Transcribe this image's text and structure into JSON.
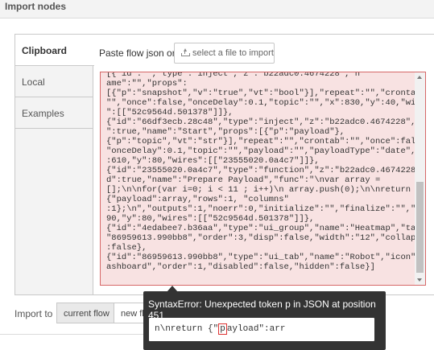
{
  "dialog": {
    "title": "Import nodes"
  },
  "tabs": [
    {
      "label": "Clipboard",
      "active": true
    },
    {
      "label": "Local",
      "active": false
    },
    {
      "label": "Examples",
      "active": false
    }
  ],
  "clipboard": {
    "paste_label": "Paste flow json or",
    "file_button_label": "select a file to import",
    "file_icon": "upload-icon"
  },
  "editor": {
    "lines": [
      "[{\"id\":\"\",\"type\":\"inject\",\"z\":\"b22adc0.4674228\",\"n",
      "ame\":\"\",\"props\":",
      "[{\"p\":\"snapshot\",\"v\":\"true\",\"vt\":\"bool\"}],\"repeat\":\"\",\"crontab\":",
      "\"\",\"once\":false,\"onceDelay\":0.1,\"topic\":\"\",\"x\":830,\"y\":40,\"wires",
      "\":[[\"52c9564d.501378\"]]},",
      "{\"id\":\"66df3ecb.28c48\",\"type\":\"inject\",\"z\":\"b22adc0.4674228\",\"d",
      "\":true,\"name\":\"Start\",\"props\":[{\"p\":\"payload\"},",
      "{\"p\":\"topic\",\"vt\":\"str\"}],\"repeat\":\"\",\"crontab\":\"\",\"once\":false,",
      "\"onceDelay\":0.1,\"topic\":\"\",\"payload\":\"\",\"payloadType\":\"date\",\"x\"",
      ":610,\"y\":80,\"wires\":[[\"23555020.0a4c7\"]]},",
      "{\"id\":\"23555020.0a4c7\",\"type\":\"function\",\"z\":\"b22adc0.4674228\",\"",
      "d\":true,\"name\":\"Prepare Payload\",\"func\":\"\\nvar array =",
      "[];\\n\\nfor(var i=0; i < 11 ; i++)\\n array.push(0);\\n\\nreturn",
      "{\"payload\":array,\"rows\":1, \"columns\"",
      ":1};\\n\",\"outputs\":1,\"noerr\":0,\"initialize\":\"\",\"finalize\":\"\",\"x\":7",
      "90,\"y\":80,\"wires\":[[\"52c9564d.501378\"]]},",
      "{\"id\":\"4edabee7.b36aa\",\"type\":\"ui_group\",\"name\":\"Heatmap\",\"tab\":",
      "\"86959613.990bb8\",\"order\":3,\"disp\":false,\"width\":\"12\",\"collapse\"",
      ":false},",
      "{\"id\":\"86959613.990bb8\",\"type\":\"ui_tab\",\"name\":\"Robot\",\"icon\":\"d",
      "ashboard\",\"order\":1,\"disabled\":false,\"hidden\":false}]"
    ]
  },
  "import_to": {
    "label": "Import to",
    "current_flow_label": "current flow",
    "new_flow_label": "new fl"
  },
  "error_tooltip": {
    "message": "SyntaxError: Unexpected token p in JSON at position 451",
    "snippet_before": "n\\nreturn {\"",
    "snippet_mark": "p",
    "snippet_after": "ayload\":arr"
  },
  "colors": {
    "error_border": "#d66767",
    "error_background": "#f8e2e2",
    "tooltip_background": "#333333"
  }
}
